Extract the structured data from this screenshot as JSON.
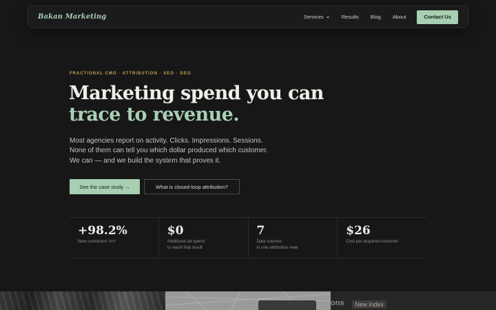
{
  "nav": {
    "brand": "Bakan Marketing",
    "links": [
      "Services",
      "Results",
      "Blog",
      "About"
    ],
    "cta": "Contact Us"
  },
  "hero": {
    "eyebrow": "FRACTIONAL CMO · ATTRIBUTION · SEO · GEO",
    "headline_line1": "Marketing spend you can",
    "headline_line2": "trace to revenue.",
    "lede": [
      "Most agencies report on activity. Clicks. Impressions. Sessions.",
      "None of them can tell you which dollar produced which customer.",
      "We can — and we build the system that proves it."
    ],
    "primary_cta": "See the case study →",
    "secondary_cta": "What is closed-loop attribution?"
  },
  "stats": [
    {
      "value": "+98.2%",
      "label_lines": [
        "New customers YoY"
      ]
    },
    {
      "value": "$0",
      "label_lines": [
        "Additional ad spend",
        "to reach that result"
      ]
    },
    {
      "value": "7",
      "label_lines": [
        "Data sources",
        "in one attribution view"
      ]
    },
    {
      "value": "$26",
      "label_lines": [
        "Cost per acquired customer"
      ]
    }
  ],
  "strip": {
    "tail_text": "ons",
    "badge": "New index"
  },
  "colors": {
    "background": "#171717",
    "accent": "#a8d0b4",
    "eyebrow": "#c9a05a"
  }
}
